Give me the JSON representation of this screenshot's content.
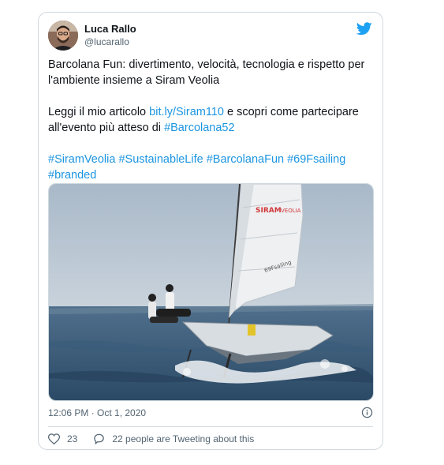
{
  "tweet": {
    "author_name": "Luca Rallo",
    "author_handle": "@lucarallo",
    "text_line1": "Barcolana Fun: divertimento, velocità, tecnologia e rispetto per l'ambiente insieme a Siram Veolia",
    "text_line2_before": "Leggi il mio articolo ",
    "text_line2_link": "bit.ly/Siram110",
    "text_line2_middle": " e scopri come partecipare all'evento più atteso di ",
    "text_line2_hashtag": "#Barcolana52",
    "hashtags": [
      "#SiramVeolia",
      "#SustainableLife",
      "#BarcolanaFun",
      "#69Fsailing",
      "#branded"
    ],
    "timestamp": "12:06 PM · Oct 1, 2020",
    "likes": "23",
    "people_tweeting": "22 people are Tweeting about this"
  },
  "media": {
    "sail_brand": "SIRAM",
    "sail_brand2": "VEOLIA",
    "sail_mark": "69Fsailing"
  },
  "icons": {
    "brand": "twitter-bird-icon",
    "info": "info-icon",
    "like": "heart-icon",
    "reply": "speech-bubble-icon"
  },
  "colors": {
    "twitter_blue": "#1da1f2",
    "link": "#1b95e0",
    "muted": "#536471",
    "border": "#cfd9de"
  }
}
